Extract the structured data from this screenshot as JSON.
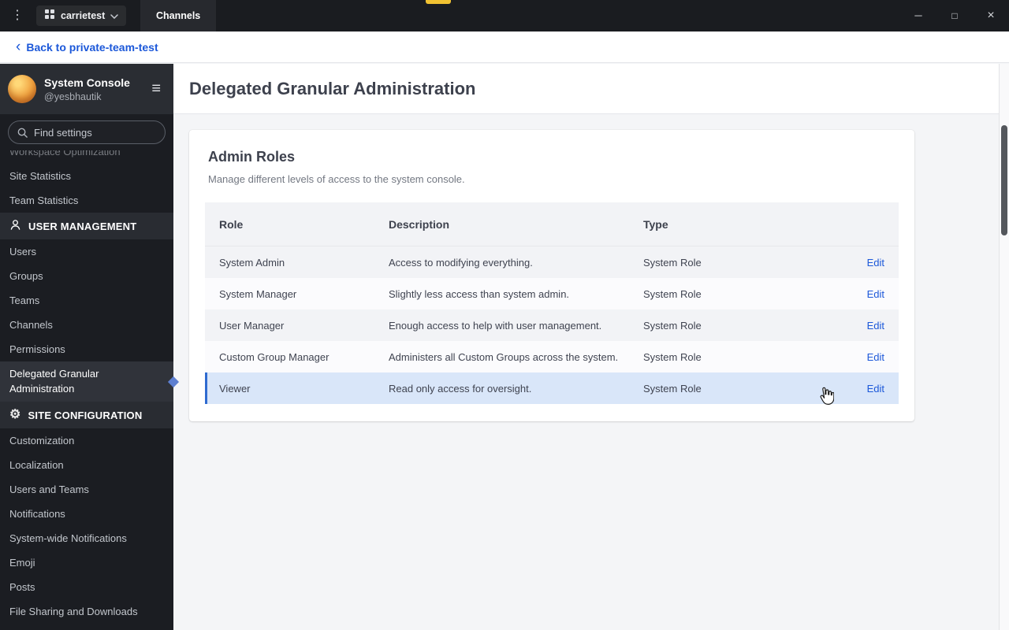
{
  "icons": {
    "menu_dots": "⋮",
    "hamburger": "≡",
    "back_chevron": "‹",
    "gear": "⚙"
  },
  "window": {
    "titlebar": {
      "server_name": "carrietest",
      "tab_label": "Channels",
      "controls": {
        "minimize": "─",
        "maximize": "□",
        "close": "×"
      }
    },
    "back_link_label": "Back to private-team-test"
  },
  "sidebar": {
    "header": {
      "title": "System Console",
      "subtitle": "@yesbhautik"
    },
    "search": {
      "placeholder": "Find settings"
    },
    "nav": {
      "top_items": [
        "Workspace Optimization",
        "Site Statistics",
        "Team Statistics"
      ],
      "sections": [
        {
          "header": "USER MANAGEMENT",
          "items": [
            "Users",
            "Groups",
            "Teams",
            "Channels",
            "Permissions",
            "Delegated Granular Administration"
          ],
          "active_item": "Delegated Granular Administration"
        },
        {
          "header": "SITE CONFIGURATION",
          "items": [
            "Customization",
            "Localization",
            "Users and Teams",
            "Notifications",
            "System-wide Notifications",
            "Emoji",
            "Posts",
            "File Sharing and Downloads"
          ]
        }
      ]
    }
  },
  "main": {
    "page_title": "Delegated Granular Administration",
    "card": {
      "title": "Admin Roles",
      "subtitle": "Manage different levels of access to the system console.",
      "table": {
        "headers": [
          "Role",
          "Description",
          "Type"
        ],
        "rows": [
          {
            "role": "System Admin",
            "description": "Access to modifying everything.",
            "type": "System Role",
            "action": "Edit"
          },
          {
            "role": "System Manager",
            "description": "Slightly less access than system admin.",
            "type": "System Role",
            "action": "Edit"
          },
          {
            "role": "User Manager",
            "description": "Enough access to help with user management.",
            "type": "System Role",
            "action": "Edit"
          },
          {
            "role": "Custom Group Manager",
            "description": "Administers all Custom Groups across the system.",
            "type": "System Role",
            "action": "Edit"
          },
          {
            "role": "Viewer",
            "description": "Read only access for oversight.",
            "type": "System Role",
            "action": "Edit"
          }
        ],
        "highlighted_row": "Viewer"
      }
    }
  },
  "colors": {
    "accent_blue": "#1c58d9",
    "row_highlight": "#d9e6f9",
    "active_indicator": "#5d7fd0"
  }
}
